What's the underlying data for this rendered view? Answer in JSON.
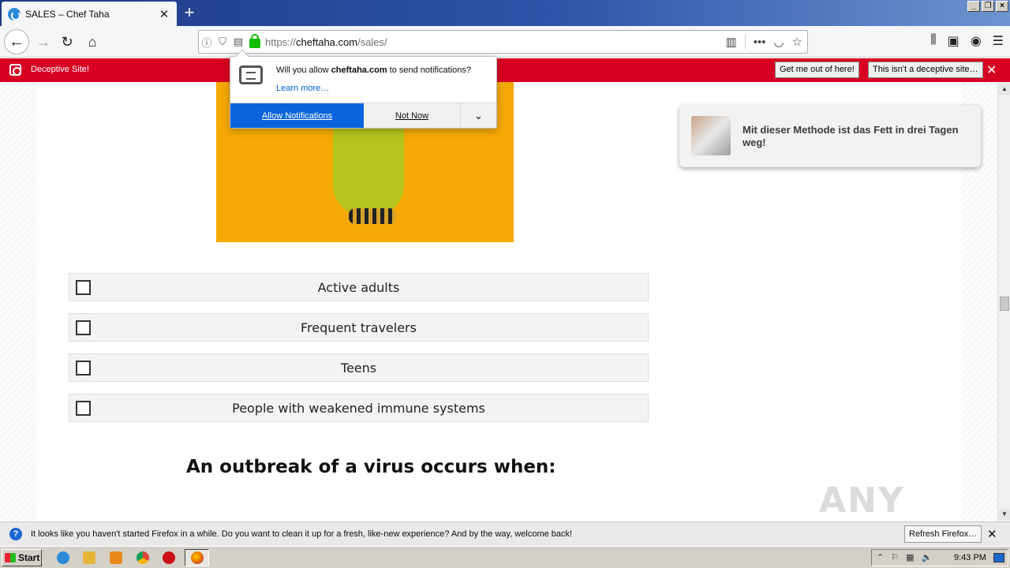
{
  "browser": {
    "tab_title": "SALES – Chef Taha",
    "tab_close": "✕",
    "new_tab": "+",
    "url_prefix": "https://",
    "url_host": "cheftaha.com",
    "url_path": "/sales/"
  },
  "deceptive_bar": {
    "label": "Deceptive Site!",
    "get_out_button": "Get me out of here!",
    "not_deceptive_button": "This isn't a deceptive site…",
    "close": "✕"
  },
  "permission_popup": {
    "message_before": "Will you allow ",
    "message_site": "cheftaha.com",
    "message_after": " to send notifications?",
    "learn_more": "Learn more…",
    "allow_button": "Allow Notifications",
    "not_now_button": "Not Now",
    "more_button": "⌄"
  },
  "page": {
    "options": [
      {
        "label": "Active adults"
      },
      {
        "label": "Frequent travelers"
      },
      {
        "label": "Teens"
      },
      {
        "label": "People with weakened immune systems"
      }
    ],
    "question_title": "An outbreak of a virus occurs when:",
    "promo_text": "Mit dieser Methode ist das Fett in drei Tagen weg!",
    "watermark": "ANY RUN"
  },
  "notice_bar": {
    "icon": "?",
    "text": "It looks like you haven't started Firefox in a while. Do you want to clean it up for a fresh, like-new experience? And by the way, welcome back!",
    "refresh_button": "Refresh Firefox…",
    "close": "✕"
  },
  "taskbar": {
    "start_label": "Start",
    "clock": "9:43 PM"
  },
  "colors": {
    "deceptive_red": "#d70022",
    "allow_blue": "#0a64dd",
    "hero_orange": "#f5a906"
  }
}
